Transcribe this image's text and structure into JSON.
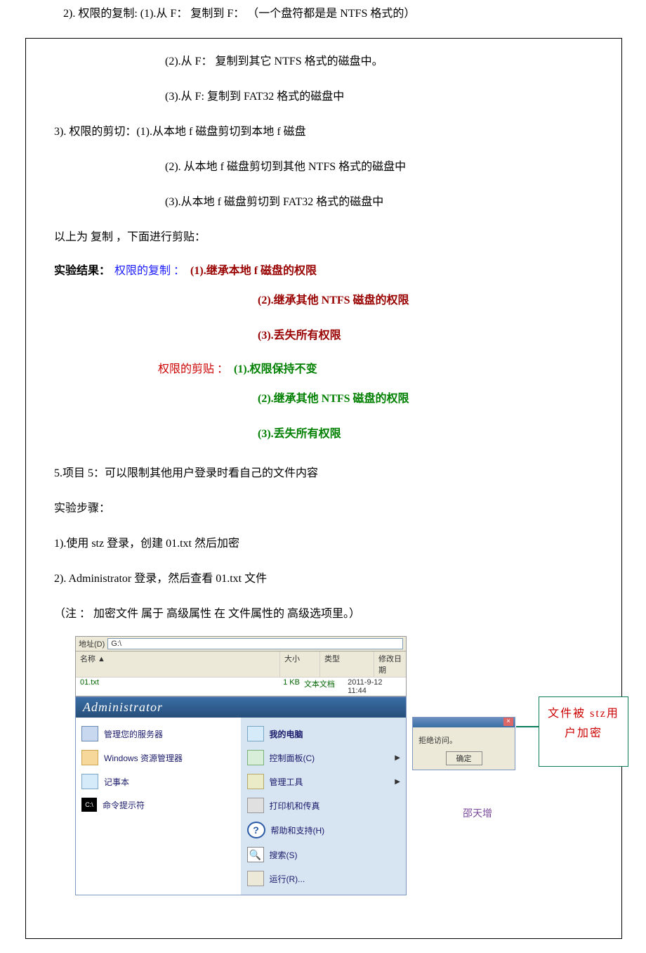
{
  "top_outside": "2).  权限的复制: (1).从  F：  复制到  F：  （一个盘符都是是 NTFS 格式的）",
  "p1": "(2).从  F：  复制到其它  NTFS  格式的磁盘中。",
  "p2": "(3).从  F:      复制到         FAT32    格式的磁盘中",
  "p3": "3).  权限的剪切：(1).从本地 f 磁盘剪切到本地 f 磁盘",
  "p4": "(2).  从本地 f 磁盘剪切到其他 NTFS 格式的磁盘中",
  "p5": "(3).从本地 f 磁盘剪切到 FAT32 格式的磁盘中",
  "p6": "以上为  复制  ，下面进行剪贴：",
  "res_lbl": "实验结果：",
  "copy_lbl": "权限的复制  ：",
  "copy1": "(1).继承本地 f 磁盘的权限",
  "copy2": "(2).继承其他 NTFS 磁盘的权限",
  "copy3": "(3).丢失所有权限",
  "cut_lbl": "权限的剪贴  ：",
  "cut1": "(1).权限保持不变",
  "cut2": "(2).继承其他 NTFS 磁盘的权限",
  "cut3": "(3).丢失所有权限",
  "q5": "5.项目 5：可以限制其他用户登录时看自己的文件内容",
  "steps_lbl": "实验步骤：",
  "s1": "1).使用 stz  登录，创建  01.txt 然后加密",
  "s2": "2). Administrator 登录，然后查看 01.txt  文件",
  "note": "（注  ：  加密文件  属于  高级属性  在  文件属性的  高级选项里。）",
  "explorer": {
    "addr_lbl": "地址(D)",
    "addr_path": "G:\\",
    "col_name": "名称 ▲",
    "col_size": "大小",
    "col_type": "类型",
    "col_date": "修改日期",
    "file_name": "01.txt",
    "file_size": "1 KB",
    "file_type": "文本文档",
    "file_date": "2011-9-12 11:44"
  },
  "startmenu": {
    "title": "Administrator",
    "left": {
      "srv": "管理您的服务器",
      "win": "Windows 资源管理器",
      "note": "记事本",
      "cmd": "命令提示符"
    },
    "right": {
      "pc": "我的电脑",
      "ctrl": "控制面板(C)",
      "mgmt": "管理工具",
      "prn": "打印机和传真",
      "help": "帮助和支持(H)",
      "search": "搜索(S)",
      "run": "运行(R)..."
    }
  },
  "dialog": {
    "msg": "拒绝访问。",
    "ok": "确定"
  },
  "callout": "文件被  stz用户加密",
  "watermark": "邵天增"
}
